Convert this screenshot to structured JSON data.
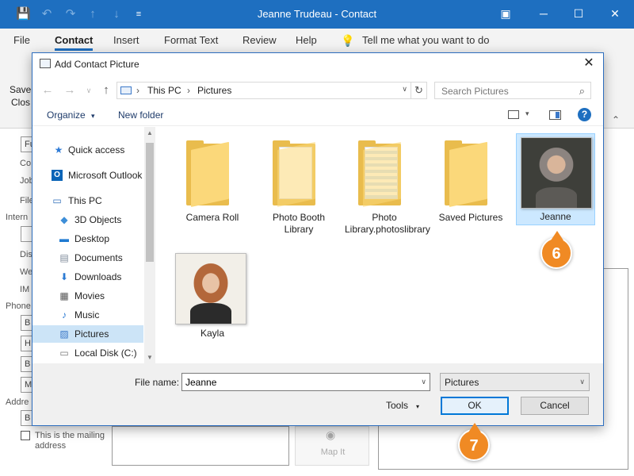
{
  "window": {
    "title": "Jeanne Trudeau  -  Contact",
    "quick_access": {
      "save": "💾",
      "undo": "↶",
      "redo": "↷",
      "up": "↑",
      "down": "↓",
      "more": "≡"
    },
    "controls": {
      "ribbon_display": "▣",
      "minimize": "─",
      "maximize": "☐",
      "close": "✕"
    }
  },
  "ribbon": {
    "tabs": [
      "File",
      "Contact",
      "Insert",
      "Format Text",
      "Review",
      "Help"
    ],
    "active_tab": "Contact",
    "tell_me": "Tell me what you want to do",
    "save_close": [
      "Save",
      "Clos"
    ]
  },
  "background_form": {
    "labels": [
      "Co",
      "Job",
      "File",
      "Intern",
      "Dis",
      "We",
      "IM",
      "Phone",
      "Addre"
    ],
    "phone_fields": [
      "B",
      "H",
      "B",
      "M"
    ],
    "address_field": "B",
    "mailing_checkbox": "This is the mailing address",
    "map_it": "Map It",
    "fu": "Fu",
    "caret": "⌃"
  },
  "dialog": {
    "title": "Add Contact Picture",
    "close": "✕",
    "nav": {
      "back": "←",
      "forward": "→",
      "dropdown": "∨",
      "up": "↑"
    },
    "address": {
      "crumbs": [
        "This PC",
        "Pictures"
      ],
      "separator": "›"
    },
    "refresh": "↻",
    "search_placeholder": "Search Pictures",
    "search_icon": "⌕",
    "commands": {
      "organize": "Organize",
      "new_folder": "New folder",
      "help": "?",
      "dropdown": "▾"
    },
    "nav_items": [
      {
        "label": "Quick access",
        "icon": "★",
        "color": "#2e7bd6"
      },
      {
        "label": "Microsoft Outlook",
        "icon": "O",
        "color": "#0a64b7"
      },
      {
        "label": "This PC",
        "icon": "▭",
        "color": "#2d6db8"
      },
      {
        "label": "3D Objects",
        "icon": "◆",
        "color": "#3d8ed8"
      },
      {
        "label": "Desktop",
        "icon": "▬",
        "color": "#1f7ad1"
      },
      {
        "label": "Documents",
        "icon": "▤",
        "color": "#7d8a99"
      },
      {
        "label": "Downloads",
        "icon": "⬇",
        "color": "#2b7ad3"
      },
      {
        "label": "Movies",
        "icon": "▦",
        "color": "#555"
      },
      {
        "label": "Music",
        "icon": "♪",
        "color": "#2b7ad3"
      },
      {
        "label": "Pictures",
        "icon": "▨",
        "color": "#3b78c8"
      },
      {
        "label": "Local Disk (C:)",
        "icon": "▭",
        "color": "#777"
      }
    ],
    "selected_nav": "Pictures",
    "items": [
      {
        "name": "Camera Roll",
        "type": "folder"
      },
      {
        "name": "Photo Booth Library",
        "type": "folder"
      },
      {
        "name": "Photo Library.photoslibrary",
        "type": "folder"
      },
      {
        "name": "Saved Pictures",
        "type": "folder"
      },
      {
        "name": "Jeanne",
        "type": "image",
        "selected": true
      },
      {
        "name": "Kayla",
        "type": "image"
      }
    ],
    "file_name_label": "File name:",
    "file_name_value": "Jeanne",
    "file_type": "Pictures",
    "tools": "Tools",
    "ok": "OK",
    "cancel": "Cancel"
  },
  "callouts": [
    "6",
    "7"
  ]
}
